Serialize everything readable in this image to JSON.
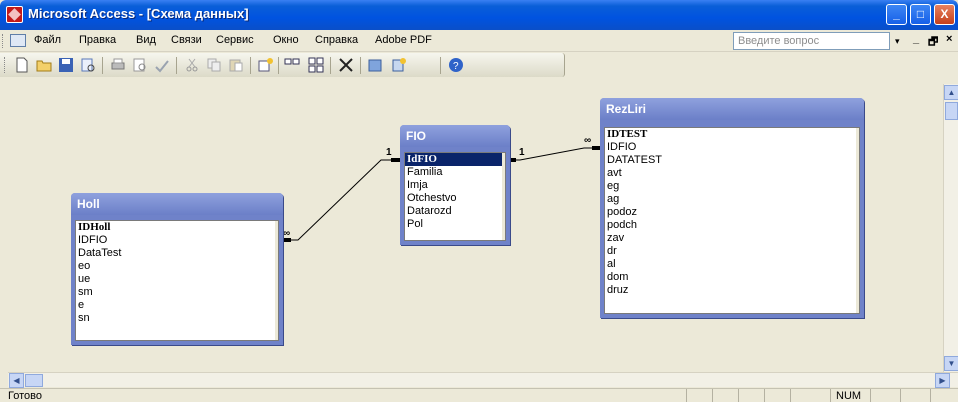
{
  "window": {
    "title": "Microsoft Access - [Схема данных]",
    "controls": {
      "minimize": "_",
      "maximize": "□",
      "close": "X"
    }
  },
  "menu": {
    "items": [
      "Файл",
      "Правка",
      "Вид",
      "Связи",
      "Сервис",
      "Окно",
      "Справка",
      "Adobe PDF"
    ],
    "ask_placeholder": "Введите вопрос",
    "ask_dropdown": "▾",
    "mdi_minimize": "_",
    "mdi_restore": "🗗",
    "mdi_close": "×"
  },
  "toolbar": {
    "icons": [
      "new-icon",
      "open-icon",
      "save-icon",
      "search-icon",
      "print-icon",
      "print-preview-icon",
      "spelling-icon",
      "cut-icon",
      "copy-icon",
      "paste-icon",
      "show-table-icon",
      "show-direct-icon",
      "show-all-icon",
      "delete-icon",
      "new-object-icon",
      "new-object-dropdown-icon",
      "help-icon"
    ]
  },
  "tables": {
    "holl": {
      "title": "Holl",
      "fields": [
        "IDHoll",
        "IDFIO",
        "DataTest",
        "eo",
        "ue",
        "sm",
        "e",
        "sn"
      ]
    },
    "fio": {
      "title": "FIO",
      "fields": [
        "IdFIO",
        "Familia",
        "Imja",
        "Otchestvo",
        "Datarozd",
        "Pol"
      ]
    },
    "rezliri": {
      "title": "RezLiri",
      "fields": [
        "IDTEST",
        "IDFIO",
        "DATATEST",
        "avt",
        "eg",
        "ag",
        "podoz",
        "podch",
        "zav",
        "dr",
        "al",
        "dom",
        "druz"
      ]
    }
  },
  "relationships": {
    "fio_holl": {
      "one": "1",
      "many": "∞"
    },
    "fio_rezliri": {
      "one": "1",
      "many": "∞"
    }
  },
  "statusbar": {
    "status": "Готово",
    "num": "NUM"
  },
  "colors": {
    "titlebar": "#0053e0",
    "table_header": "#7185cb",
    "selection": "#0a246a"
  }
}
